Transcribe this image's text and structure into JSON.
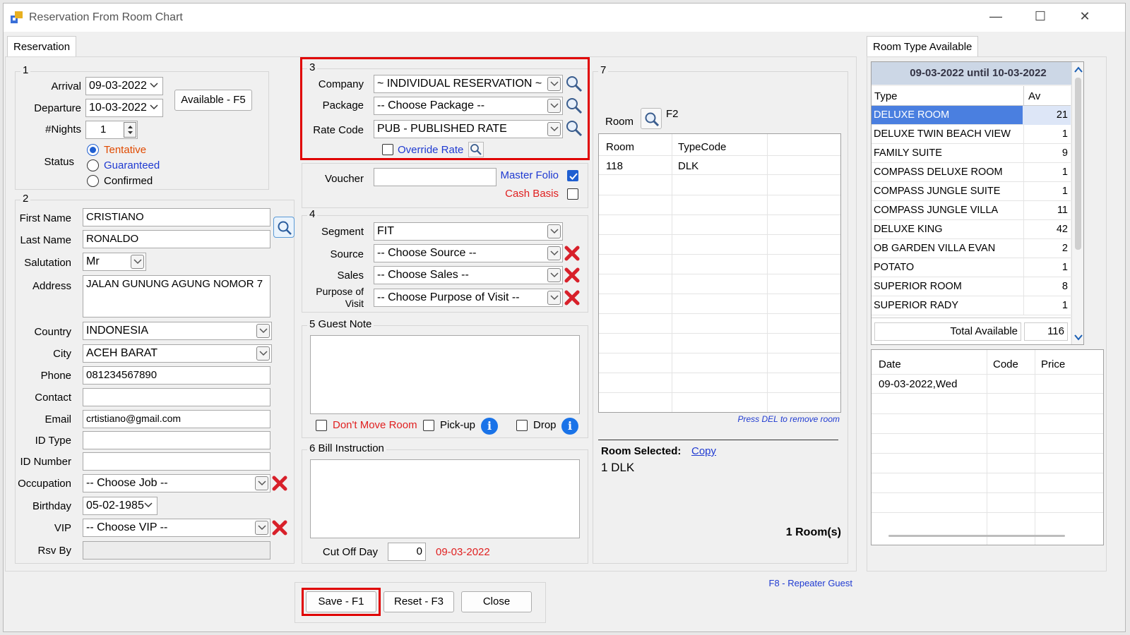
{
  "window": {
    "title": "Reservation From Room Chart",
    "minimize": "—",
    "maximize": "☐",
    "close": "✕"
  },
  "tabs": {
    "left": "Reservation",
    "right": "Room Type Available"
  },
  "g1": {
    "num": "1",
    "arrival_label": "Arrival",
    "arrival_value": "09-03-2022",
    "departure_label": "Departure",
    "departure_value": "10-03-2022",
    "nights_label": "#Nights",
    "nights_value": "1",
    "available_button": "Available - F5",
    "status_label": "Status",
    "status_options": [
      "Tentative",
      "Guaranteed",
      "Confirmed"
    ],
    "status_selected": "Tentative"
  },
  "g2": {
    "num": "2",
    "first_name_label": "First Name",
    "first_name": "CRISTIANO",
    "last_name_label": "Last Name",
    "last_name": "RONALDO",
    "salutation_label": "Salutation",
    "salutation": "Mr",
    "address_label": "Address",
    "address": "JALAN GUNUNG AGUNG NOMOR 7",
    "country_label": "Country",
    "country": "INDONESIA",
    "city_label": "City",
    "city": "ACEH BARAT",
    "phone_label": "Phone",
    "phone": "081234567890",
    "contact_label": "Contact",
    "contact": "",
    "email_label": "Email",
    "email": "crtistiano@gmail.com",
    "idtype_label": "ID Type",
    "idtype": "",
    "idnumber_label": "ID Number",
    "idnumber": "",
    "occupation_label": "Occupation",
    "occupation": "-- Choose Job --",
    "birthday_label": "Birthday",
    "birthday": "05-02-1985",
    "vip_label": "VIP",
    "vip": "-- Choose VIP --",
    "rsvby_label": "Rsv By",
    "rsvby": ""
  },
  "g3": {
    "num": "3",
    "company_label": "Company",
    "company": "~ INDIVIDUAL RESERVATION ~",
    "package_label": "Package",
    "package": "-- Choose Package --",
    "ratecode_label": "Rate Code",
    "ratecode": "PUB - PUBLISHED RATE",
    "override_label": "Override Rate"
  },
  "voucher": {
    "label": "Voucher",
    "value": "",
    "master_folio": "Master Folio",
    "master_folio_checked": true,
    "cash_basis": "Cash Basis",
    "cash_basis_checked": false
  },
  "g4": {
    "num": "4",
    "segment_label": "Segment",
    "segment": "FIT",
    "source_label": "Source",
    "source": "-- Choose Source --",
    "sales_label": "Sales",
    "sales": "-- Choose Sales --",
    "purpose_label_1": "Purpose of",
    "purpose_label_2": "Visit",
    "purpose": "-- Choose Purpose of Visit --"
  },
  "g5": {
    "title": "5 Guest Note",
    "note": "",
    "dont_move": "Don't Move Room",
    "pickup": "Pick-up",
    "drop": "Drop"
  },
  "g6": {
    "title": "6 Bill Instruction",
    "instruction": "",
    "cutoff_label": "Cut Off Day",
    "cutoff_value": "0",
    "cutoff_date": "09-03-2022"
  },
  "g7": {
    "num": "7",
    "room_label": "Room",
    "f2_label": "F2",
    "columns": [
      "Room",
      "TypeCode"
    ],
    "rows": [
      {
        "room": "118",
        "typecode": "DLK"
      }
    ],
    "press_del": "Press DEL to remove room",
    "room_selected_label": "Room Selected:",
    "copy_link": "Copy",
    "selected_value": "1 DLK",
    "rooms_count": "1 Room(s)"
  },
  "room_types": {
    "date_range": "09-03-2022 until 10-03-2022",
    "columns": [
      "Type",
      "Av"
    ],
    "rows": [
      {
        "type": "DELUXE ROOM",
        "av": "21"
      },
      {
        "type": "DELUXE TWIN BEACH VIEW",
        "av": "1"
      },
      {
        "type": "FAMILY SUITE",
        "av": "9"
      },
      {
        "type": "COMPASS DELUXE ROOM",
        "av": "1"
      },
      {
        "type": "COMPASS JUNGLE SUITE",
        "av": "1"
      },
      {
        "type": "COMPASS JUNGLE VILLA",
        "av": "11"
      },
      {
        "type": "DELUXE KING",
        "av": "42"
      },
      {
        "type": "OB GARDEN VILLA EVAN",
        "av": "2"
      },
      {
        "type": "POTATO",
        "av": "1"
      },
      {
        "type": "SUPERIOR ROOM",
        "av": "8"
      },
      {
        "type": "SUPERIOR RADY",
        "av": "1"
      }
    ],
    "total_label": "Total Available",
    "total_value": "116"
  },
  "price_grid": {
    "columns": [
      "Date",
      "Code",
      "Price"
    ],
    "rows": [
      {
        "date": "09-03-2022,Wed",
        "code": "",
        "price": ""
      }
    ]
  },
  "footer": {
    "repeater": "F8 - Repeater Guest",
    "save": "Save - F1",
    "reset": "Reset - F3",
    "close": "Close"
  },
  "colors": {
    "highlight": "#e00000",
    "selection": "#4a7fe0",
    "link": "#1f3ad1",
    "info": "#1a73e8"
  }
}
